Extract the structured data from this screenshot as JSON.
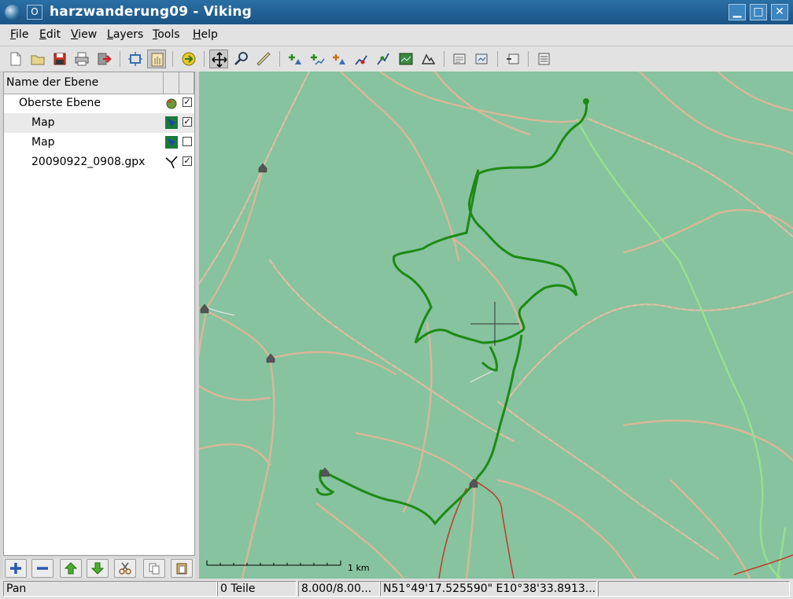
{
  "window": {
    "title": "harzwanderung09 - Viking",
    "menu_glyph": "O",
    "minimize": "▁",
    "maximize": "□",
    "close": "✕"
  },
  "menubar": {
    "items": [
      {
        "label": "File"
      },
      {
        "label": "Edit"
      },
      {
        "label": "View"
      },
      {
        "label": "Layers"
      },
      {
        "label": "Tools"
      },
      {
        "label": "Help"
      }
    ]
  },
  "toolbar": {
    "buttons": [
      "new-icon",
      "open-icon",
      "save-icon",
      "print-icon",
      "exit-icon",
      "zoom-to-fit-icon",
      "pan-hand-icon",
      "go-arrow-icon",
      "move-icon",
      "zoom-icon",
      "ruler-icon",
      "create-waypoint-icon",
      "create-track-icon",
      "edit-waypoint-icon",
      "edit-trackpoint-icon",
      "route-finder-icon",
      "map-download-icon",
      "dem-download-icon",
      "georef-icon",
      "georef-move-icon",
      "layer-properties-icon",
      "layer-list-icon"
    ]
  },
  "layers_panel": {
    "column_header": "Name der Ebene",
    "rows": [
      {
        "label": "Oberste Ebene",
        "checked": true,
        "icon": "aggregate-layer-icon"
      },
      {
        "label": "Map",
        "checked": true,
        "icon": "map-layer-icon"
      },
      {
        "label": "Map",
        "checked": false,
        "icon": "map-layer-icon"
      },
      {
        "label": "20090922_0908.gpx",
        "checked": true,
        "icon": "trw-layer-icon"
      }
    ],
    "check_mark": "✓"
  },
  "layer_buttons": [
    "add-layer-icon",
    "remove-layer-icon",
    "move-up-icon",
    "move-down-icon",
    "cut-icon",
    "copy-icon",
    "paste-icon"
  ],
  "map": {
    "scale_label": "1 km",
    "track_color": "#1e8a14",
    "background_color": "#86c39e"
  },
  "statusbar": {
    "tool": "Pan",
    "items": "0 Teile",
    "zoom": "8.000/8.00...",
    "position": "N51°49'17.525590\" E10°38'33.8913..."
  }
}
